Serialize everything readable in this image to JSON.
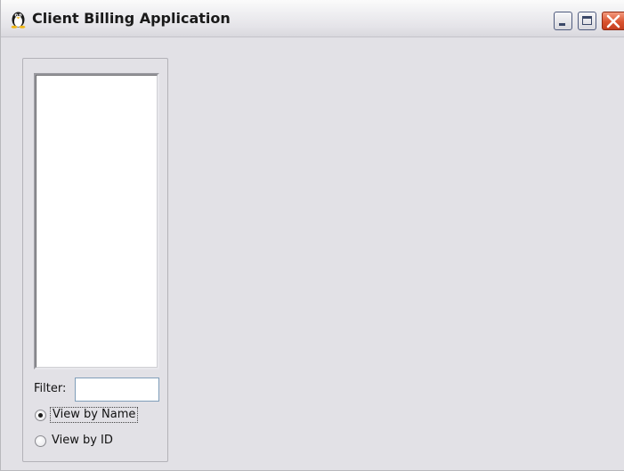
{
  "window": {
    "title": "Client Billing Application",
    "icon": "tux-penguin-icon",
    "controls": {
      "minimize": "minimize-icon",
      "maximize": "maximize-icon",
      "close": "close-icon",
      "close_color": "#d9532f"
    }
  },
  "client_panel": {
    "list_items": [],
    "filter": {
      "label": "Filter:",
      "value": "",
      "placeholder": ""
    },
    "view_options": [
      {
        "label": "View by Name",
        "selected": true
      },
      {
        "label": "View by ID",
        "selected": false
      }
    ]
  }
}
